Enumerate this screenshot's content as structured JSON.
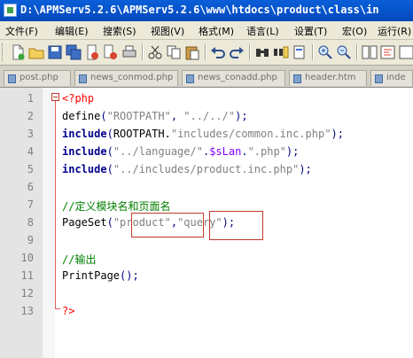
{
  "window": {
    "title": "D:\\APMServ5.2.6\\APMServ5.2.6\\www\\htdocs\\product\\class\\in"
  },
  "menu": [
    "文件(F)",
    "编辑(E)",
    "搜索(S)",
    "视图(V)",
    "格式(M)",
    "语言(L)",
    "设置(T)",
    "宏(O)",
    "运行(R)"
  ],
  "toolbar": [
    "new-file-icon",
    "open-folder-icon",
    "save-icon",
    "save-all-icon",
    "close-icon",
    "close-all-icon",
    "print-icon",
    "cut-icon",
    "copy-icon",
    "paste-icon",
    "undo-icon",
    "redo-icon",
    "find-icon",
    "replace-icon",
    "zoom-in-icon",
    "zoom-out-icon",
    "sync-icon",
    "wrap-icon"
  ],
  "tabs": [
    {
      "label": "post.php"
    },
    {
      "label": "news_conmod.php"
    },
    {
      "label": "news_conadd.php"
    },
    {
      "label": "header.htm"
    },
    {
      "label": "inde"
    }
  ],
  "editor": {
    "line_numbers": [
      "1",
      "2",
      "3",
      "4",
      "5",
      "6",
      "7",
      "8",
      "9",
      "10",
      "11",
      "12",
      "13"
    ],
    "lines": {
      "l1_open": "<?php",
      "l2_fn": "define",
      "l2_p1": "(",
      "l2_s1": "\"ROOTPATH\"",
      "l2_c": ", ",
      "l2_s2": "\"../../\"",
      "l2_p2": ");",
      "l3_kw": "include",
      "l3_p1": "(",
      "l3_const": "ROOTPATH.",
      "l3_s": "\"includes/common.inc.php\"",
      "l3_p2": ");",
      "l4_kw": "include",
      "l4_p1": "(",
      "l4_s1": "\"../language/\"",
      "l4_dot1": ".",
      "l4_var": "$sLan",
      "l4_dot2": ".",
      "l4_s2": "\".php\"",
      "l4_p2": ");",
      "l5_kw": "include",
      "l5_p1": "(",
      "l5_s": "\"../includes/product.inc.php\"",
      "l5_p2": ");",
      "l7_comment": "//定义模块名和页面名",
      "l8_fn": "PageSet",
      "l8_p1": "(",
      "l8_s1": "\"product\"",
      "l8_c": ",",
      "l8_s2": "\"query\"",
      "l8_p2": ");",
      "l10_comment": "//输出",
      "l11_fn": "PrintPage",
      "l11_p": "();",
      "l13_close": "?>"
    }
  },
  "colors": {
    "keyword": "#00008b",
    "string": "#808080",
    "comment": "#008000",
    "php_tag": "#ff0000",
    "highlight_box": "#c0392b"
  }
}
